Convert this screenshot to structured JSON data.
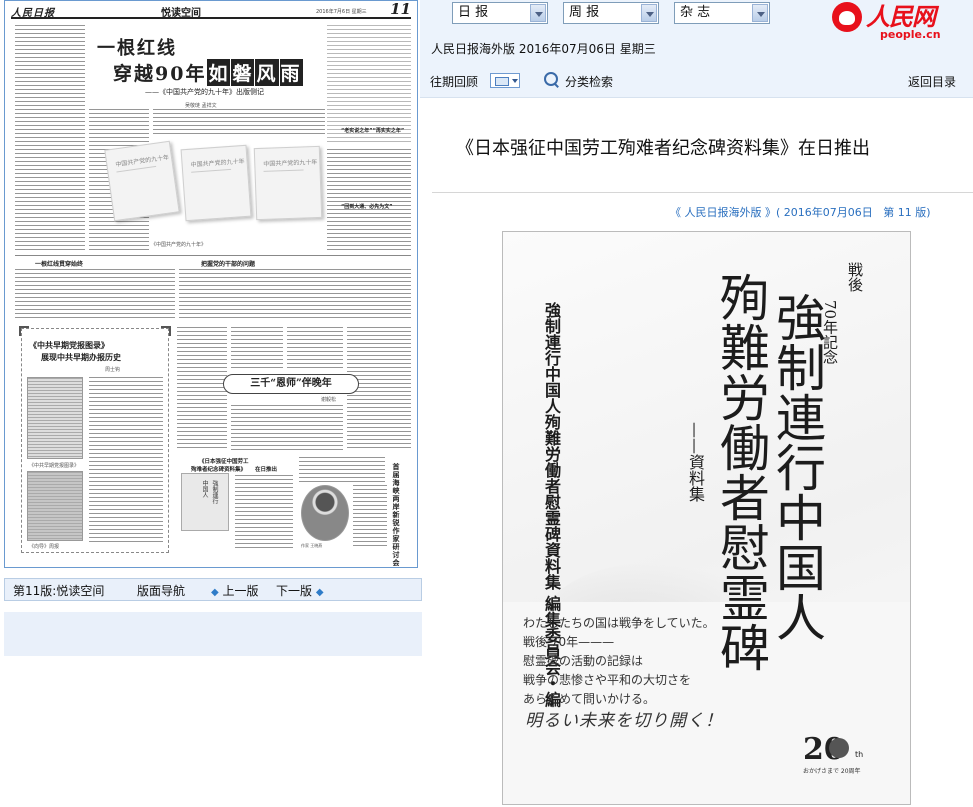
{
  "newspaper": {
    "logo": "人民日报",
    "section": "悦读空间",
    "date_line": "2016年7月6日 星期三",
    "page_number": "11",
    "headline_line1": "一根红线",
    "headline_line2_plain": "穿越90年",
    "headline_line2_boxed": [
      "如",
      "磐",
      "风",
      "雨"
    ],
    "headline_sub": "——《中国共产党的九十年》出版侧记",
    "byline": "吴敬琏 孟祥文",
    "book_spine_text": "中国共产党的九十年",
    "caption_books": "《中国共产党的九十年》",
    "mid_title_1": "把握党的干部的问题",
    "mid_title_2": "一根红线贯穿始终",
    "col_title": "“老实说之年”“再实实之年”",
    "col_title_2": "“回到大通、必先为文”",
    "box_title_1": "《中共早期党报图录》",
    "box_title_2": "展现中共早期办报历史",
    "box_author": "周士钩",
    "box_caption_1": "《中共早期党报图录》",
    "box_caption_2": "《向导》周报",
    "sanqian_title": "三千“恩师”伴晚年",
    "sanqian_author": "谢毅松",
    "jp_title_1": "《日本强征中国劳工",
    "jp_title_2": "殉难者纪念碑资料集》",
    "jp_title_3": "在日推出",
    "jp_thumb_text": [
      "強制連行",
      "中国人"
    ],
    "photo_caption": "作家 王晓燕",
    "vertical_title": "首届海峡两岸新锐作家研讨会"
  },
  "page_nav": {
    "edition": "第11版:悦读空间",
    "layout_nav": "版面导航",
    "prev": "上一版",
    "next": "下一版"
  },
  "top_bar": {
    "selects": [
      {
        "name": "daily",
        "value": "日 报"
      },
      {
        "name": "weekly",
        "value": "周 报"
      },
      {
        "name": "magazine",
        "value": "杂 志"
      }
    ],
    "edition_info": "人民日报海外版  2016年07月06日  星期三",
    "brand_cn": "人民网",
    "brand_en": "people.cn"
  },
  "toolbar": {
    "back_issues": "往期回顾",
    "category_search": "分类检索",
    "back_to_index": "返回目录"
  },
  "article": {
    "title": "《日本强征中国劳工殉难者纪念碑资料集》在日推出",
    "source_prefix": "《 人民日报海外版 》( ",
    "source_date": "2016年07月06日",
    "source_page": "第 11 版",
    "source_suffix": ")"
  },
  "cover": {
    "edition_mark_1": "戦後",
    "edition_mark_2": "70年記念",
    "main_col_1": "強制連行中国人",
    "main_col_2": "殉難労働者慰霊碑",
    "subtitle": "——資料集",
    "org": "強制連行中国人殉難労働者慰霊碑資料集 編集委員会・編",
    "lines": [
      "わたしたちの国は戦争をしていた。",
      "戦後 70年———",
      "慰霊碑の活動の記録は",
      "戦争の悲惨さや平和の大切さを",
      "あらためて問いかける。"
    ],
    "handwritten": "明るい未来を切り開く！",
    "badge_num": "20",
    "badge_th": "th",
    "badge_caption": "おかげさまで 20周年"
  }
}
